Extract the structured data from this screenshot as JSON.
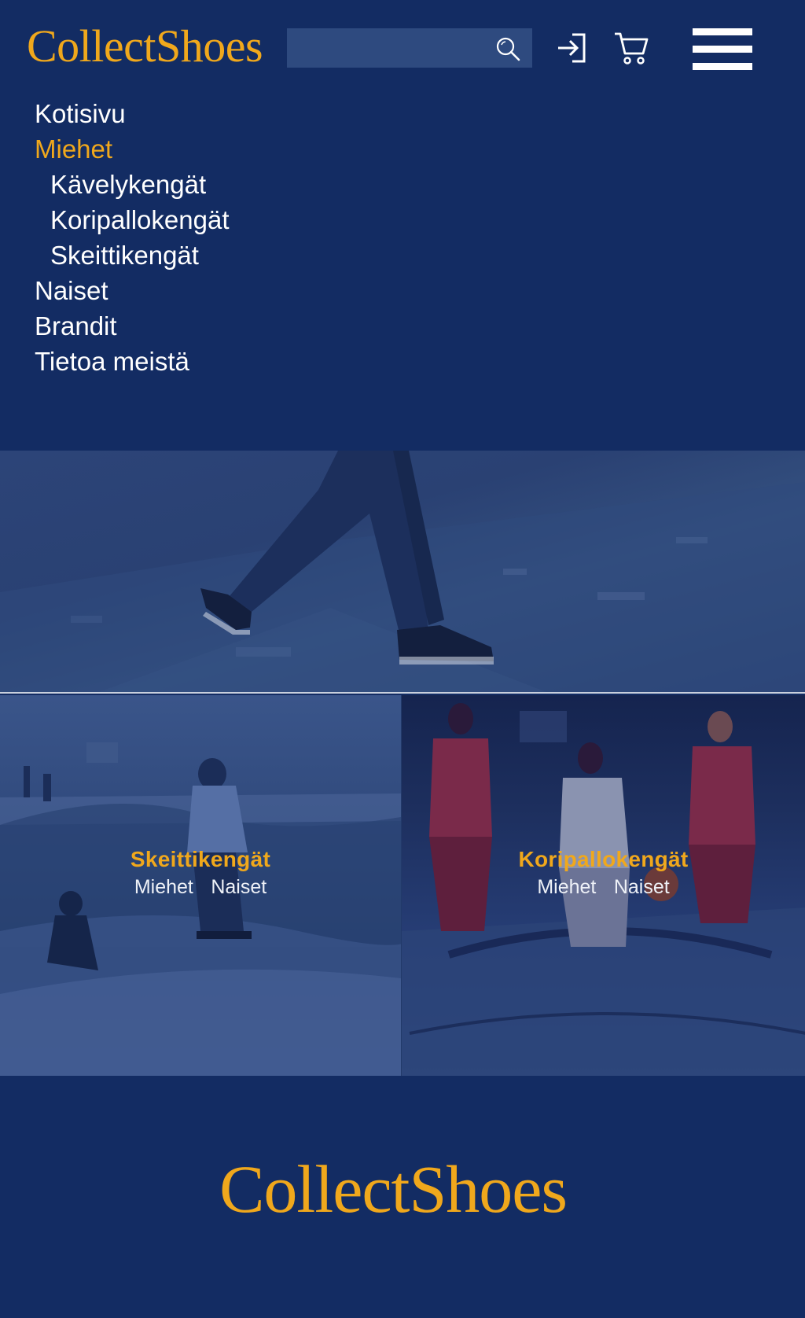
{
  "header": {
    "logo": "CollectShoes",
    "search_placeholder": ""
  },
  "nav": {
    "items": [
      {
        "label": "Kotisivu"
      },
      {
        "label": "Miehet",
        "active": true
      },
      {
        "label": "Kävelykengät",
        "sub": true
      },
      {
        "label": "Koripallokengät",
        "sub": true
      },
      {
        "label": "Skeittikengät",
        "sub": true
      },
      {
        "label": "Naiset"
      },
      {
        "label": "Brandit"
      },
      {
        "label": "Tietoa meistä"
      }
    ]
  },
  "tiles": [
    {
      "title": "Skeittikengät",
      "links": [
        "Miehet",
        "Naiset"
      ]
    },
    {
      "title": "Koripallokengät",
      "links": [
        "Miehet",
        "Naiset"
      ]
    }
  ],
  "footer": {
    "logo": "CollectShoes"
  },
  "colors": {
    "background": "#132c63",
    "accent": "#f0a81c",
    "text": "#ffffff"
  },
  "icons": [
    "search-icon",
    "login-icon",
    "cart-icon",
    "hamburger-menu-icon"
  ]
}
